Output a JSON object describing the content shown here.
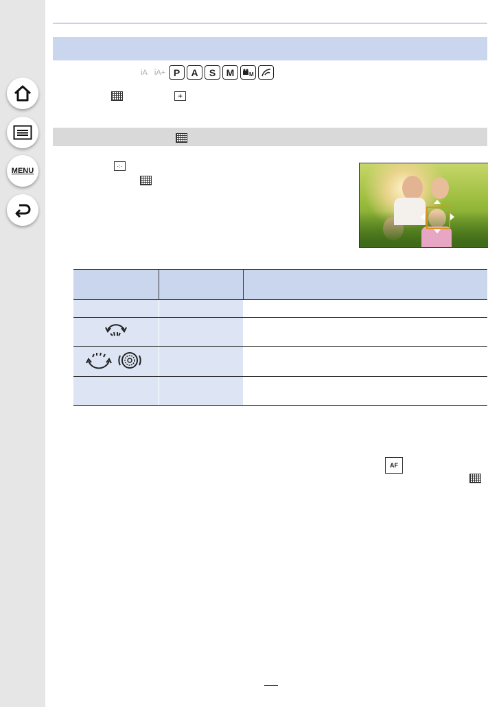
{
  "sidebar": {
    "home_icon": "home-icon",
    "contents_icon": "list-icon",
    "menu_label": "MENU",
    "back_icon": "back-icon"
  },
  "modes": {
    "ghost": [
      "iA",
      "iA+"
    ],
    "keys": [
      "P",
      "A",
      "S",
      "M"
    ],
    "extra_icons": [
      "movie-manual-icon",
      "creative-control-icon"
    ]
  },
  "table": {
    "row_icons": [
      "",
      "front-dial-icon",
      "rear-dial-icon",
      ""
    ]
  },
  "colors": {
    "header_bar": "#c9d6ee",
    "section_bar": "#d9d9d9",
    "sidebar": "#e6e6e6",
    "af_frame": "#e0901e"
  }
}
